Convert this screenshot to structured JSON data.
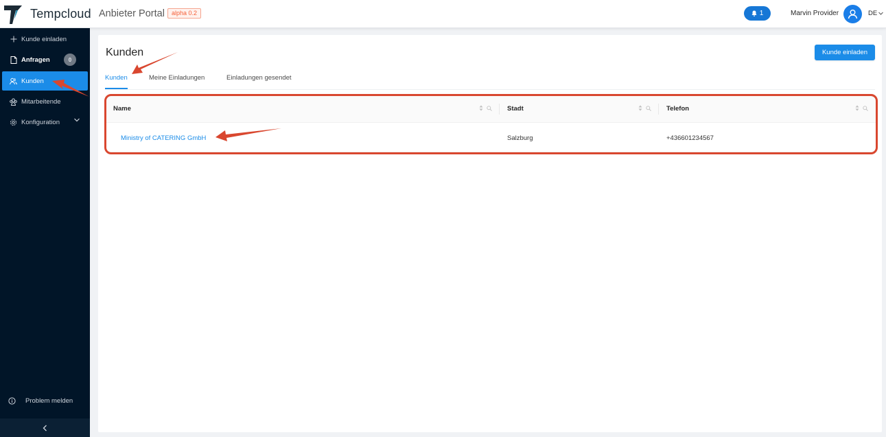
{
  "header": {
    "brand": "Tempcloud",
    "portal": "Anbieter Portal",
    "version_badge": "alpha 0.2",
    "notification_count": "1",
    "user_name": "Marvin Provider",
    "language": "DE"
  },
  "sidebar": {
    "items": [
      {
        "label": "Kunde einladen",
        "icon": "plus-icon"
      },
      {
        "label": "Anfragen",
        "icon": "document-icon",
        "badge": "0"
      },
      {
        "label": "Kunden",
        "icon": "users-icon",
        "active": true
      },
      {
        "label": "Mitarbeitende",
        "icon": "team-icon"
      },
      {
        "label": "Konfiguration",
        "icon": "gear-icon"
      }
    ],
    "problem_label": "Problem melden"
  },
  "main": {
    "title": "Kunden",
    "invite_button": "Kunde einladen",
    "tabs": [
      {
        "label": "Kunden",
        "active": true
      },
      {
        "label": "Meine Einladungen"
      },
      {
        "label": "Einladungen gesendet"
      }
    ],
    "table": {
      "columns": [
        "Name",
        "Stadt",
        "Telefon"
      ],
      "rows": [
        {
          "name": "Ministry of CATERING GmbH",
          "city": "Salzburg",
          "phone": "+436601234567"
        }
      ]
    }
  },
  "colors": {
    "accent": "#1b8ce8",
    "sidebar_bg": "#011528",
    "annotation": "#d9472f"
  }
}
